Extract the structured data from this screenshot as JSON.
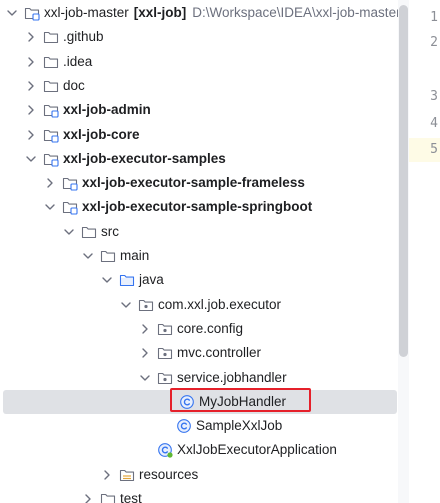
{
  "project": {
    "name": "xxl-job-master",
    "module": "[xxl-job]",
    "path": "D:\\Workspace\\IDEA\\xxl-job-master"
  },
  "tree": [
    {
      "label": "xxl-job-master",
      "expanded": true,
      "chevron": "down",
      "icon": "module-folder",
      "bold": false
    },
    {
      "label": ".github",
      "chevron": "right",
      "icon": "folder"
    },
    {
      "label": ".idea",
      "chevron": "right",
      "icon": "folder"
    },
    {
      "label": "doc",
      "chevron": "right",
      "icon": "folder"
    },
    {
      "label": "xxl-job-admin",
      "chevron": "right",
      "icon": "module-folder",
      "bold": true
    },
    {
      "label": "xxl-job-core",
      "chevron": "right",
      "icon": "module-folder",
      "bold": true
    },
    {
      "label": "xxl-job-executor-samples",
      "chevron": "down",
      "icon": "module-folder",
      "bold": true
    },
    {
      "label": "xxl-job-executor-sample-frameless",
      "chevron": "right",
      "icon": "module-folder",
      "bold": true
    },
    {
      "label": "xxl-job-executor-sample-springboot",
      "chevron": "down",
      "icon": "module-folder",
      "bold": true
    },
    {
      "label": "src",
      "chevron": "down",
      "icon": "folder"
    },
    {
      "label": "main",
      "chevron": "down",
      "icon": "folder"
    },
    {
      "label": "java",
      "chevron": "down",
      "icon": "source-folder"
    },
    {
      "label": "com.xxl.job.executor",
      "chevron": "down",
      "icon": "package"
    },
    {
      "label": "core.config",
      "chevron": "right",
      "icon": "package"
    },
    {
      "label": "mvc.controller",
      "chevron": "right",
      "icon": "package"
    },
    {
      "label": "service.jobhandler",
      "chevron": "down",
      "icon": "package"
    },
    {
      "label": "MyJobHandler",
      "chevron": "none",
      "icon": "class",
      "selected": true
    },
    {
      "label": "SampleXxlJob",
      "chevron": "none",
      "icon": "class"
    },
    {
      "label": "XxlJobExecutorApplication",
      "chevron": "none",
      "icon": "spring-class"
    },
    {
      "label": "resources",
      "chevron": "right",
      "icon": "resources-folder"
    },
    {
      "label": "test",
      "chevron": "right",
      "icon": "folder"
    }
  ],
  "editor": {
    "line_numbers": [
      "1",
      "2",
      "3",
      "4",
      "5"
    ]
  },
  "colors": {
    "selection_bg": "#dfe1e5",
    "highlight_border": "#e5202a",
    "class_icon": "#3574f0",
    "folder_icon": "#6c707e",
    "source_folder_icon": "#3574f0",
    "resources_folder_icon": "#e2a53a"
  }
}
